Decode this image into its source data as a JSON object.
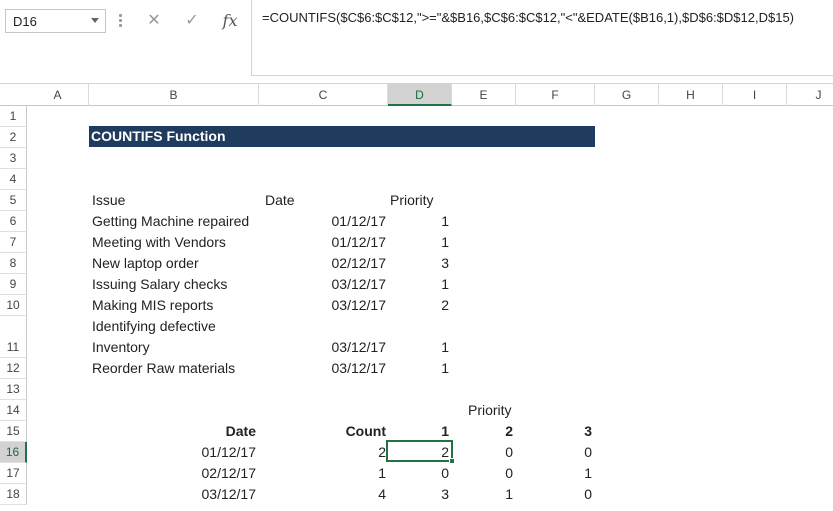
{
  "name_box": "D16",
  "formula_bar": {
    "cancel_icon": "✕",
    "enter_icon": "✓",
    "fx_label": "fx",
    "formula": "=COUNTIFS($C$6:$C$12,\">=\"&$B16,$C$6:$C$12,\"<\"&EDATE($B16,1),$D$6:$D$12,D$15)"
  },
  "columns": [
    "A",
    "B",
    "C",
    "D",
    "E",
    "F",
    "G",
    "H",
    "I",
    "J"
  ],
  "selected_column": "D",
  "rows": [
    "1",
    "2",
    "3",
    "4",
    "5",
    "6",
    "7",
    "8",
    "9",
    "10",
    "11",
    "12",
    "13",
    "14",
    "15",
    "16",
    "17",
    "18"
  ],
  "selected_row": "16",
  "title": "COUNTIFS Function",
  "table_headers": {
    "issue": "Issue",
    "date": "Date",
    "priority": "Priority"
  },
  "issues": [
    {
      "issue": "Getting Machine repaired",
      "date": "01/12/17",
      "priority": "1"
    },
    {
      "issue": "Meeting with Vendors",
      "date": "01/12/17",
      "priority": "1"
    },
    {
      "issue": "New laptop order",
      "date": "02/12/17",
      "priority": "3"
    },
    {
      "issue": "Issuing Salary checks",
      "date": "03/12/17",
      "priority": "1"
    },
    {
      "issue": "Making MIS reports",
      "date": "03/12/17",
      "priority": "2"
    },
    {
      "issue_line1": "Identifying defective",
      "issue": "Inventory",
      "date": "03/12/17",
      "priority": "1"
    },
    {
      "issue": "Reorder Raw materials",
      "date": "03/12/17",
      "priority": "1"
    }
  ],
  "summary": {
    "priority_header": "Priority",
    "date_header": "Date",
    "count_header": "Count",
    "p1": "1",
    "p2": "2",
    "p3": "3",
    "rows": [
      {
        "date": "01/12/17",
        "count": "2",
        "p1": "2",
        "p2": "0",
        "p3": "0"
      },
      {
        "date": "02/12/17",
        "count": "1",
        "p1": "0",
        "p2": "0",
        "p3": "1"
      },
      {
        "date": "03/12/17",
        "count": "4",
        "p1": "3",
        "p2": "1",
        "p3": "0"
      }
    ]
  }
}
